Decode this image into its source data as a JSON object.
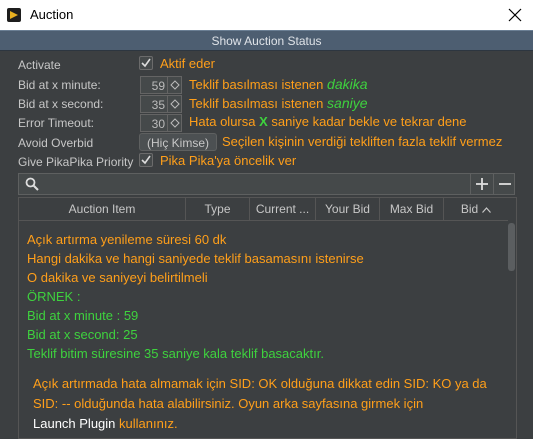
{
  "window": {
    "title": "Auction",
    "close_icon": "close-icon",
    "app_icon": "auction-app-icon"
  },
  "status_button": {
    "label": "Show Auction Status"
  },
  "settings": {
    "activate": {
      "label": "Activate",
      "checked": true,
      "desc": "Aktif eder"
    },
    "bid_minute": {
      "label": "Bid at x minute:",
      "value": "59",
      "desc_prefix": "Teklif basılması istenen",
      "desc_highlight": "dakika"
    },
    "bid_second": {
      "label": "Bid at x second:",
      "value": "35",
      "desc_prefix": "Teklif basılması istenen",
      "desc_highlight": "saniye"
    },
    "error_timeout": {
      "label": "Error Timeout:",
      "value": "30",
      "desc_prefix": "Hata olursa",
      "desc_highlight": "X",
      "desc_suffix": "saniye kadar bekle ve tekrar dene"
    },
    "avoid_overbid": {
      "label": "Avoid Overbid",
      "button": "(Hiç Kimse)",
      "desc": "Seçilen kişinin verdiği tekliften fazla teklif vermez"
    },
    "priority": {
      "label": "Give PikaPika Priority",
      "checked": true,
      "desc": "Pika Pika'ya öncelik ver"
    }
  },
  "search": {
    "placeholder": "",
    "add_icon": "plus-icon",
    "remove_icon": "minus-icon"
  },
  "table": {
    "columns": [
      "Auction Item",
      "Type",
      "Current ...",
      "Your Bid",
      "Max Bid",
      "Bid"
    ],
    "sorted_column": "Bid"
  },
  "info": {
    "line1": "Açık artırma  yenileme  süresi  60 dk",
    "line2": "Hangi  dakika  ve  hangi  saniyede  teklif  basamasını istenirse",
    "line3": "O dakika ve saniyeyi  belirtilmeli",
    "line4": "ÖRNEK :",
    "line5": "Bid at x minute :  59",
    "line6": "Bid at x second:  25",
    "line7": "Teklif  bitim süresine 35 saniye  kala teklif  basacaktır.",
    "line8": "Açık artırmada hata almamak için SID: OK olduğuna dikkat edin SID: KO ya da",
    "line9": "SID: -- olduğunda hata alabilirsiniz. Oyun arka sayfasına girmek için",
    "line10_a": "Launch  Plugin",
    "line10_b": "kullanınız."
  },
  "colors": {
    "accent_orange": "#ff9f1a",
    "accent_green": "#3ed23e",
    "status_bar": "#4d5e71",
    "panel": "#3c3f41"
  }
}
